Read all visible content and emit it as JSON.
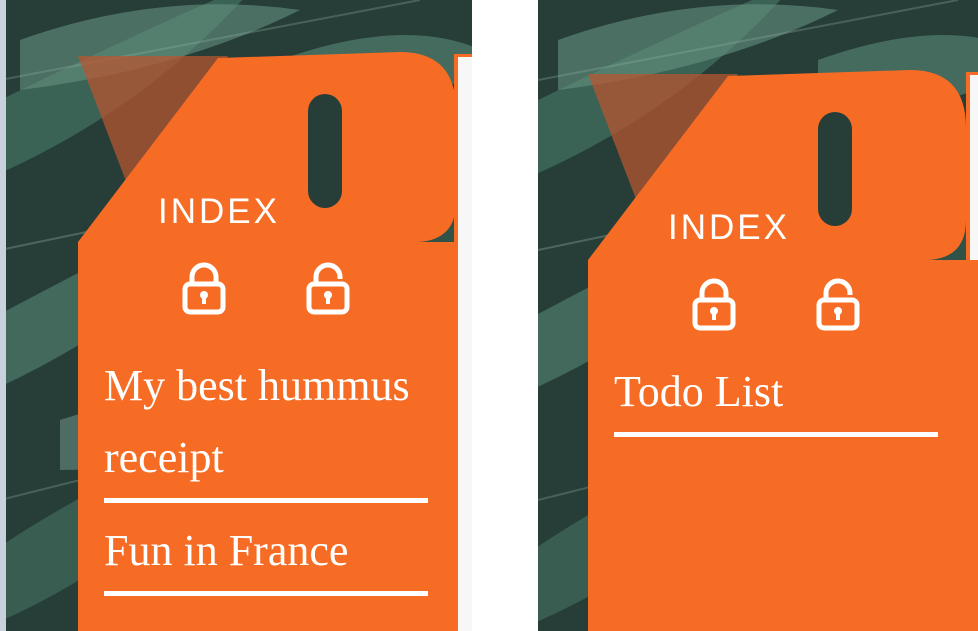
{
  "colors": {
    "accent": "#f76c24",
    "text": "#ffffff",
    "foliage_dark": "#223a35",
    "foliage_light": "#5f8f7e"
  },
  "left_card": {
    "title": "INDEX",
    "lock_icon": "lock-closed-icon",
    "unlock_icon": "lock-open-icon",
    "notes": [
      {
        "title": "My best hummus receipt"
      },
      {
        "title": "Fun in France"
      }
    ]
  },
  "right_card": {
    "title": "INDEX",
    "lock_icon": "lock-closed-icon",
    "unlock_icon": "lock-open-icon",
    "notes": [
      {
        "title": "Todo List"
      }
    ]
  }
}
